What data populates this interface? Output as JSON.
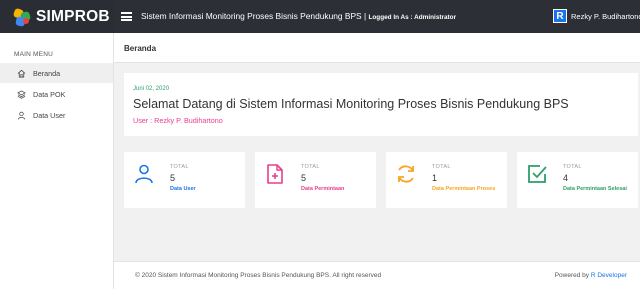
{
  "brand": {
    "name": "SIMPROB"
  },
  "header": {
    "title": "Sistem Informasi Monitoring Proses Bisnis Pendukung BPS |",
    "logged_in": "Logged In As : Administrator",
    "user_initial": "R",
    "user_name": "Rezky P. Budihartono"
  },
  "sidebar": {
    "menu_header": "MAIN MENU",
    "items": [
      {
        "label": "Beranda",
        "icon": "home-icon",
        "active": true
      },
      {
        "label": "Data POK",
        "icon": "layers-icon",
        "active": false
      },
      {
        "label": "Data User",
        "icon": "user-icon",
        "active": false
      }
    ]
  },
  "page": {
    "title": "Beranda"
  },
  "welcome": {
    "date": "Juni 02, 2020",
    "title": "Selamat Datang di Sistem Informasi Monitoring Proses Bisnis Pendukung BPS",
    "user": "User : Rezky P. Budihartono"
  },
  "stats": [
    {
      "label": "TOTAL",
      "value": "5",
      "caption": "Data User",
      "color": "#1a73e8",
      "icon": "user-icon"
    },
    {
      "label": "TOTAL",
      "value": "5",
      "caption": "Data Permintaan",
      "color": "#e83e8c",
      "icon": "file-plus-icon"
    },
    {
      "label": "TOTAL",
      "value": "1",
      "caption": "Data Permintaan Proses",
      "color": "#f5a623",
      "icon": "refresh-icon"
    },
    {
      "label": "TOTAL",
      "value": "4",
      "caption": "Data Permintaan Selesai",
      "color": "#2e9e6a",
      "icon": "check-square-icon"
    }
  ],
  "footer": {
    "copyright": "© 2020 Sistem Informasi Monitoring Proses Bisnis Pendukung BPS. All right reserved",
    "powered_prefix": "Powered by",
    "powered_name": "R Developer"
  }
}
